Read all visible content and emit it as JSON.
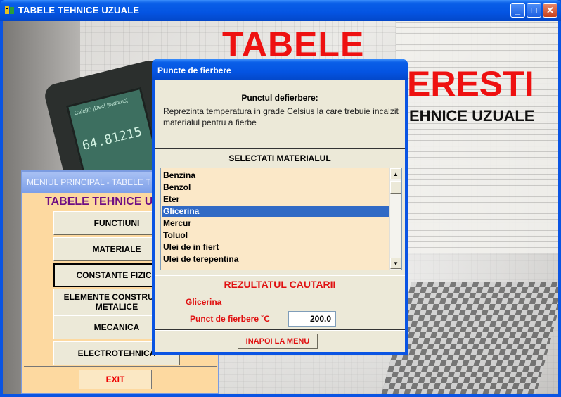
{
  "main_window": {
    "title": "TABELE TEHNICE UZUALE",
    "controls": {
      "minimize": "_",
      "maximize": "□",
      "close": "✕"
    }
  },
  "background": {
    "title_line1": "TABELE",
    "title_line2": "ERESTI",
    "title_line3": "EHNICE UZUALE",
    "calculator": {
      "menu": "Calc90 |Dec| |radians|",
      "readout": "64.81215"
    }
  },
  "menu_window": {
    "title": "MENIUL PRINCIPAL - TABELE T",
    "heading": "TABELE TEHNICE U",
    "buttons": [
      "FUNCTIUNI",
      "MATERIALE",
      "CONSTANTE FIZICE",
      "ELEMENTE CONSTRUCTII METALICE",
      "MECANICA",
      "ELECTROTEHNICA"
    ],
    "exit": "EXIT"
  },
  "dialog": {
    "title": "Puncte de fierbere",
    "definition_heading": "Punctul defierbere:",
    "definition_text": "Reprezinta temperatura in grade Celsius la care trebuie incalzit materialul pentru a fierbe",
    "select_heading": "SELECTATI MATERIALUL",
    "materials": [
      "Benzina",
      "Benzol",
      "Eter",
      "Glicerina",
      "Mercur",
      "Toluol",
      "Ulei de in fiert",
      "Ulei de terepentina"
    ],
    "selected_index": 3,
    "result_heading": "REZULTATUL CAUTARII",
    "result_material": "Glicerina",
    "result_label": "Punct de fierbere ˚C",
    "result_value": "200.0",
    "back_button": "INAPOI LA MENU"
  },
  "colors": {
    "accent_red": "#e01010",
    "titlebar_blue": "#0454e2",
    "menu_bg": "#fdd9a0",
    "selection": "#316ac5"
  }
}
